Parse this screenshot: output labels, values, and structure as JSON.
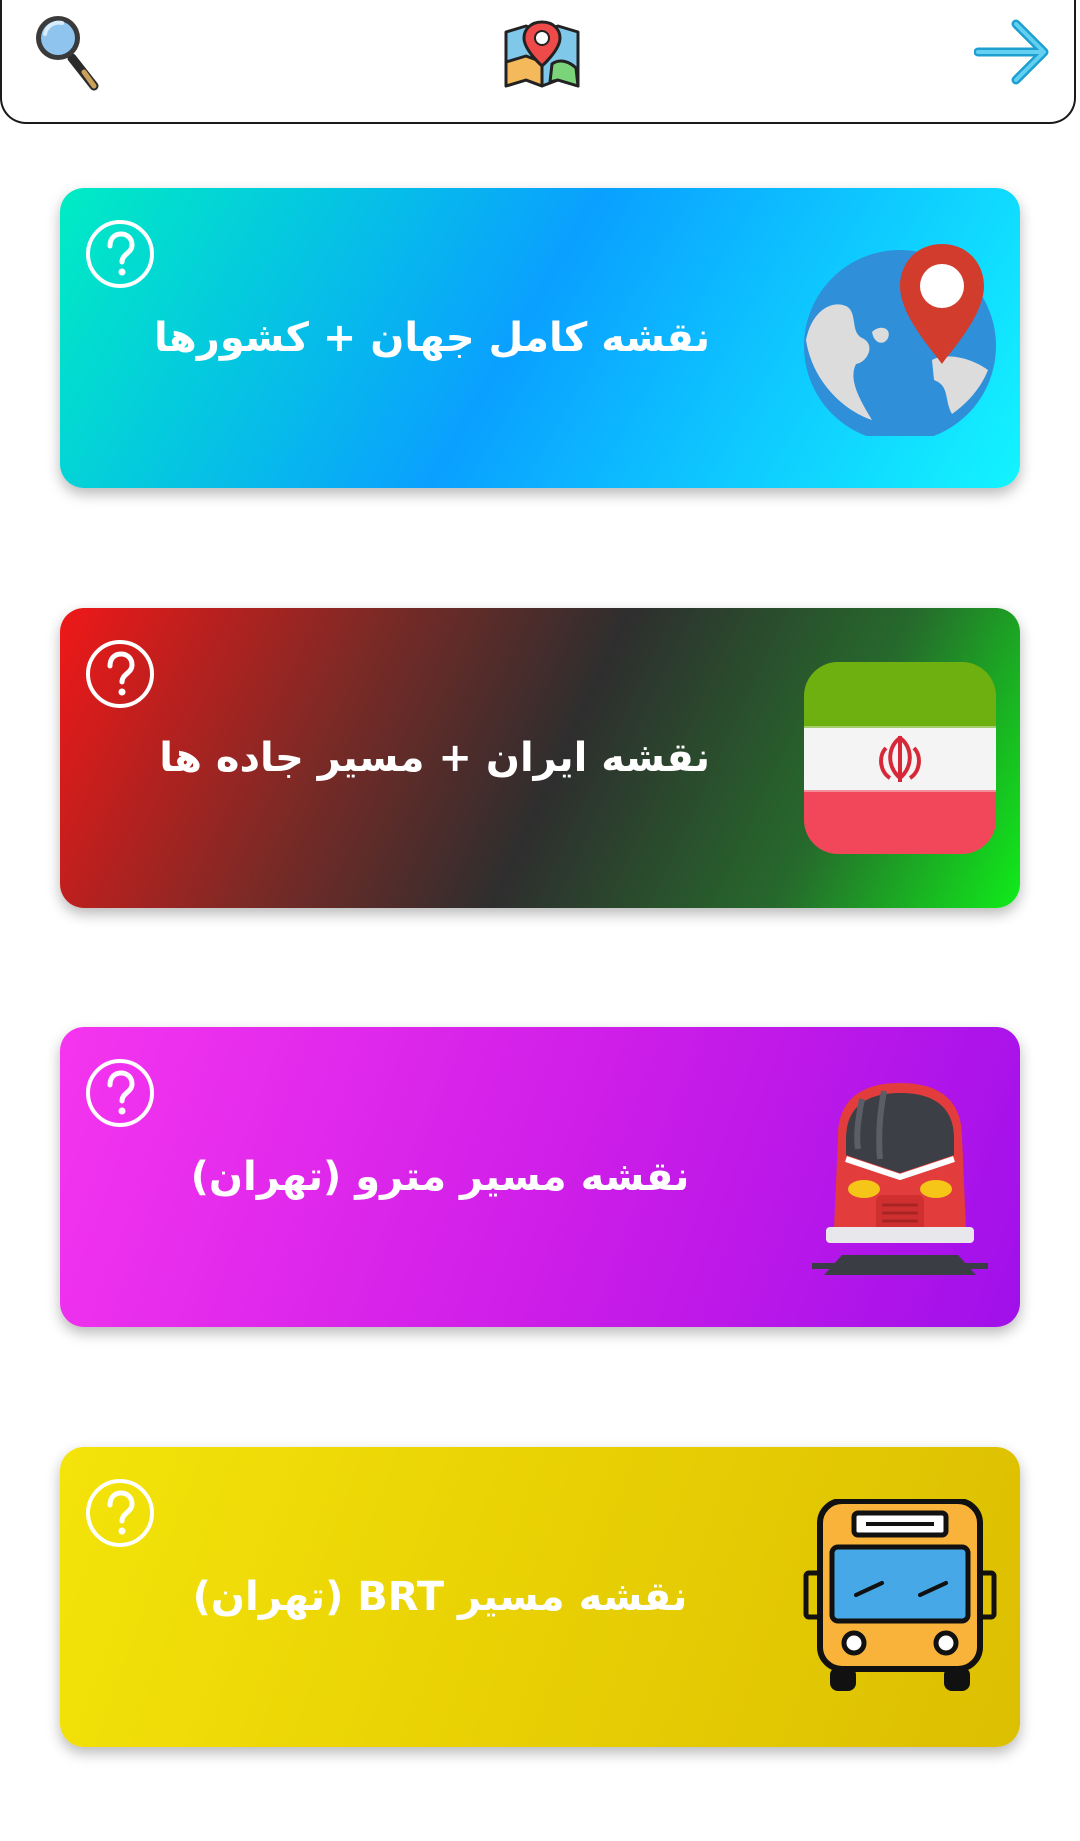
{
  "header": {
    "search_icon": "magnifier-icon",
    "logo_icon": "map-pin-logo-icon",
    "forward_icon": "arrow-right-icon"
  },
  "cards": [
    {
      "title": "نقشه کامل جهان + کشورها",
      "icon": "globe-pin-icon",
      "help_icon": "help-circle-icon",
      "gradient": [
        "#00ecc3",
        "#0aa0ff",
        "#13f4ff"
      ]
    },
    {
      "title": "نقشه ایران + مسیر جاده ها",
      "icon": "iran-flag-icon",
      "help_icon": "help-circle-icon",
      "gradient": [
        "#f01818",
        "#2e2e2e",
        "#10ec1a"
      ]
    },
    {
      "title": "نقشه مسیر مترو (تهران)",
      "icon": "metro-train-icon",
      "help_icon": "help-circle-icon",
      "gradient": [
        "#f535ef",
        "#cc1de8",
        "#a010ea"
      ]
    },
    {
      "title": "نقشه مسیر BRT (تهران)",
      "icon": "bus-icon",
      "help_icon": "help-circle-icon",
      "gradient": [
        "#f4e40a",
        "#e8d004",
        "#dcbf02"
      ]
    }
  ]
}
